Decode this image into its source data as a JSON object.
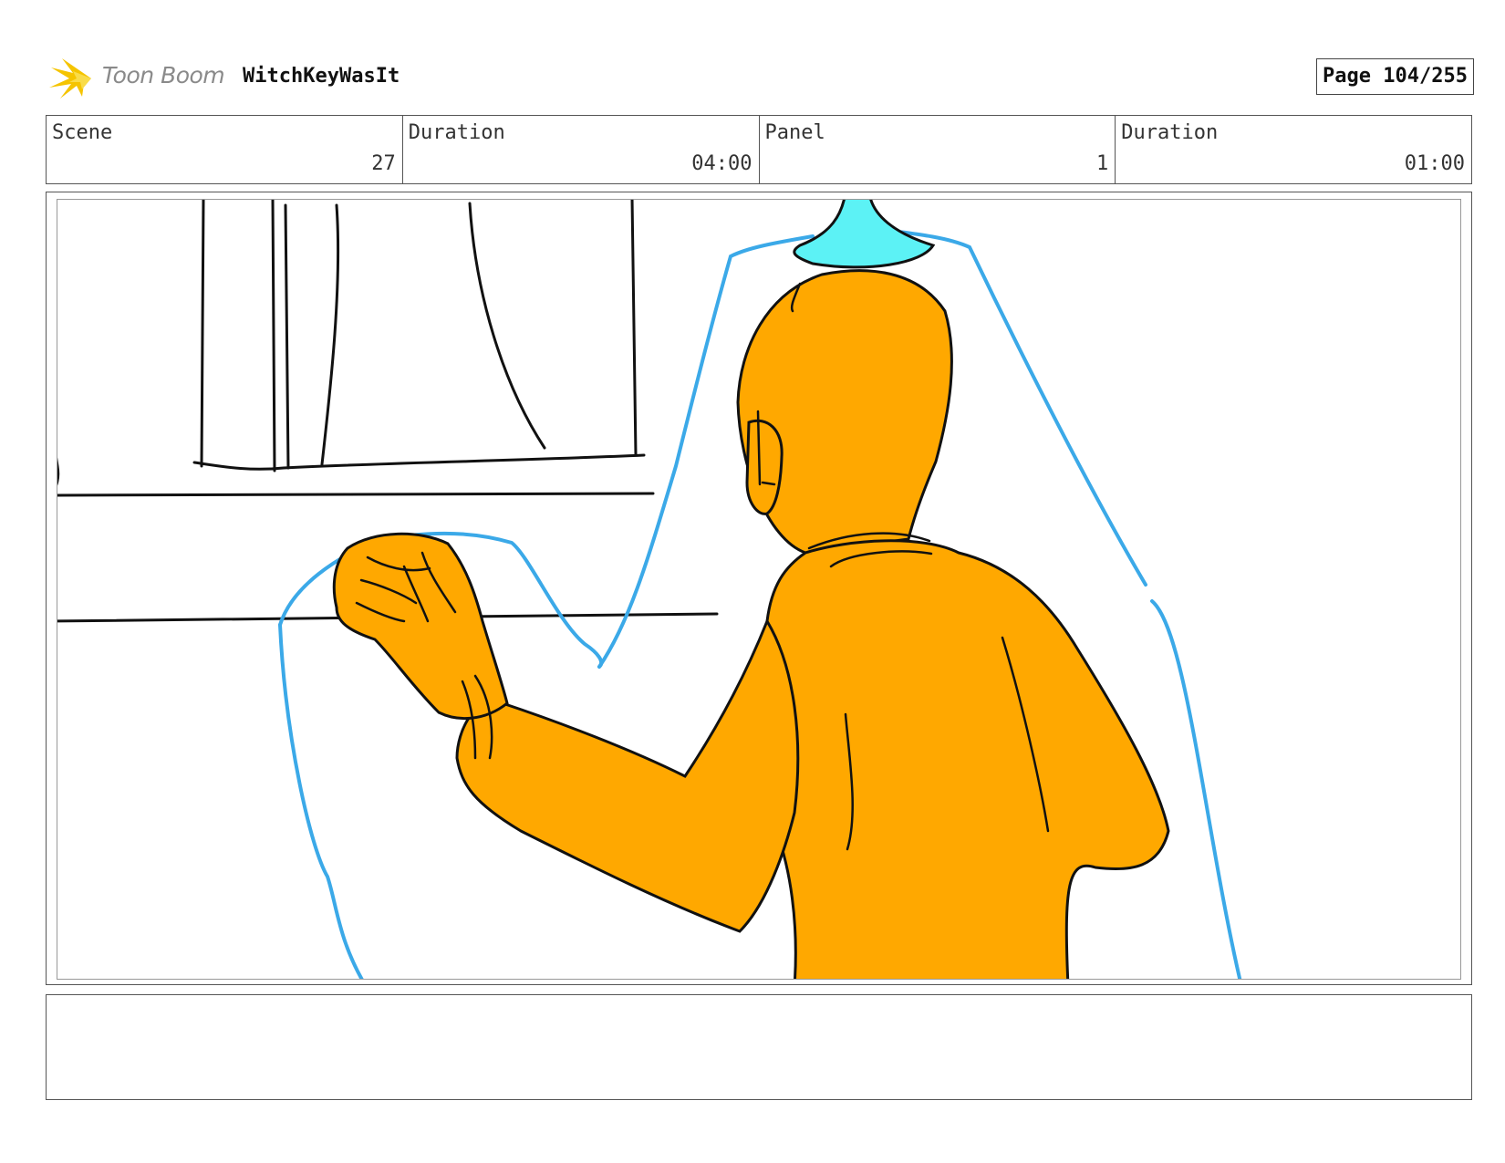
{
  "header": {
    "logo_text": "Toon Boom",
    "project_title": "WitchKeyWasIt",
    "page_label": "Page 104/255"
  },
  "info": {
    "scene_label": "Scene",
    "scene_value": "27",
    "scene_duration_label": "Duration",
    "scene_duration_value": "04:00",
    "panel_label": "Panel",
    "panel_value": "1",
    "panel_duration_label": "Duration",
    "panel_duration_value": "01:00"
  },
  "notes": {
    "text": ""
  },
  "colors": {
    "character_fill": "#FFA800",
    "guide_line": "#3BA9E8",
    "light_fixture": "#5CF2F5",
    "ink": "#111111",
    "logo_accent": "#F5C400"
  }
}
